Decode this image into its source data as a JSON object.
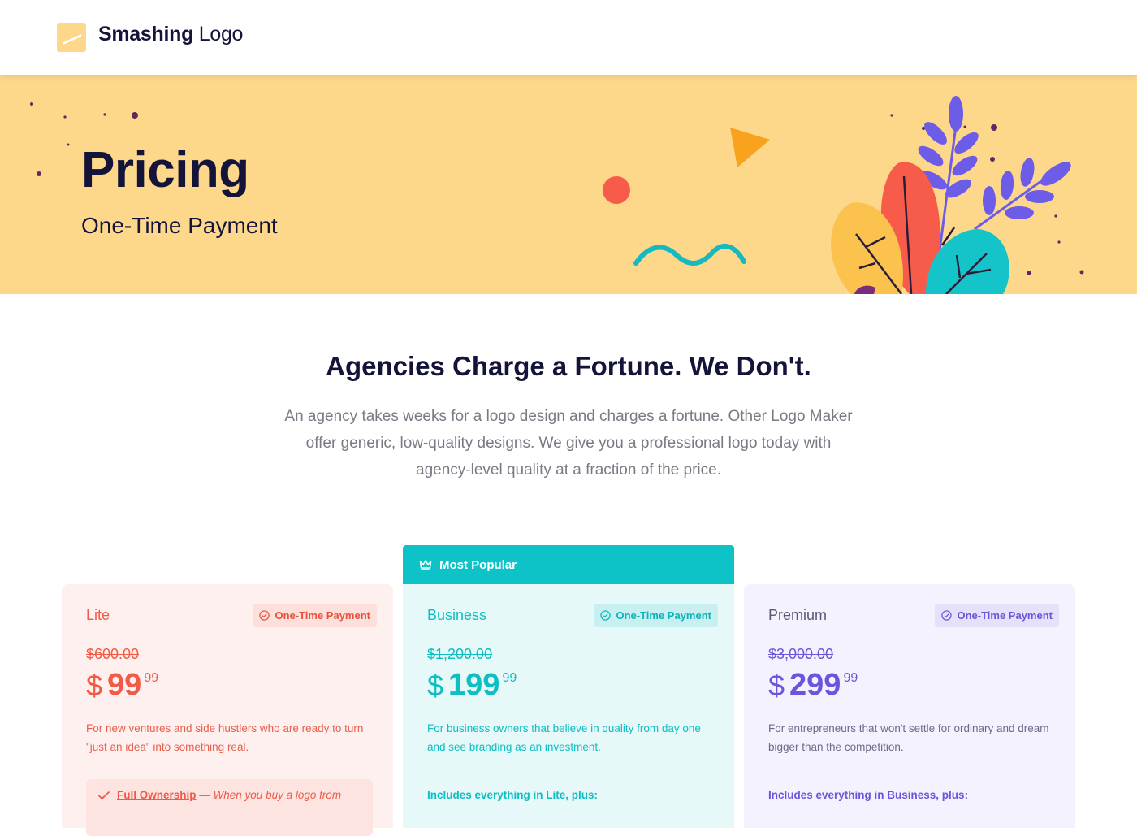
{
  "header": {
    "brand_bold": "Smashing",
    "brand_light": "Logo",
    "logo_color": "#fdd88a"
  },
  "hero": {
    "title": "Pricing",
    "subtitle": "One-Time Payment",
    "background": "#fdd88a"
  },
  "intro": {
    "title": "Agencies Charge a Fortune. We Don't.",
    "body": "An agency takes weeks for a logo design and charges a fortune. Other Logo Maker offer generic, low-quality designs. We give you a professional logo today with agency-level quality at a fraction of the price."
  },
  "popular_banner": {
    "icon": "crown-icon",
    "label": "Most Popular",
    "color": "#0dc3c8"
  },
  "plans": [
    {
      "name": "Lite",
      "badge": "One-Time Payment",
      "old_price": "$600.00",
      "currency": "$",
      "price_whole": "99",
      "price_cents": "99",
      "description": "For new ventures and side hustlers who are ready to turn \"just an idea\" into something real.",
      "feature_title": "Full Ownership",
      "feature_text": "When you buy a logo from",
      "accent": "#f05a46"
    },
    {
      "name": "Business",
      "badge": "One-Time Payment",
      "old_price": "$1,200.00",
      "currency": "$",
      "price_whole": "199",
      "price_cents": "99",
      "description": "For business owners that believe in quality from day one and see branding as an investment.",
      "includes": "Includes everything in Lite, plus:",
      "accent": "#0dbec3"
    },
    {
      "name": "Premium",
      "badge": "One-Time Payment",
      "old_price": "$3,000.00",
      "currency": "$",
      "price_whole": "299",
      "price_cents": "99",
      "description": "For entrepreneurs that won't settle for ordinary and dream bigger than the competition.",
      "includes": "Includes everything in Business, plus:",
      "accent": "#6a55dc"
    }
  ]
}
